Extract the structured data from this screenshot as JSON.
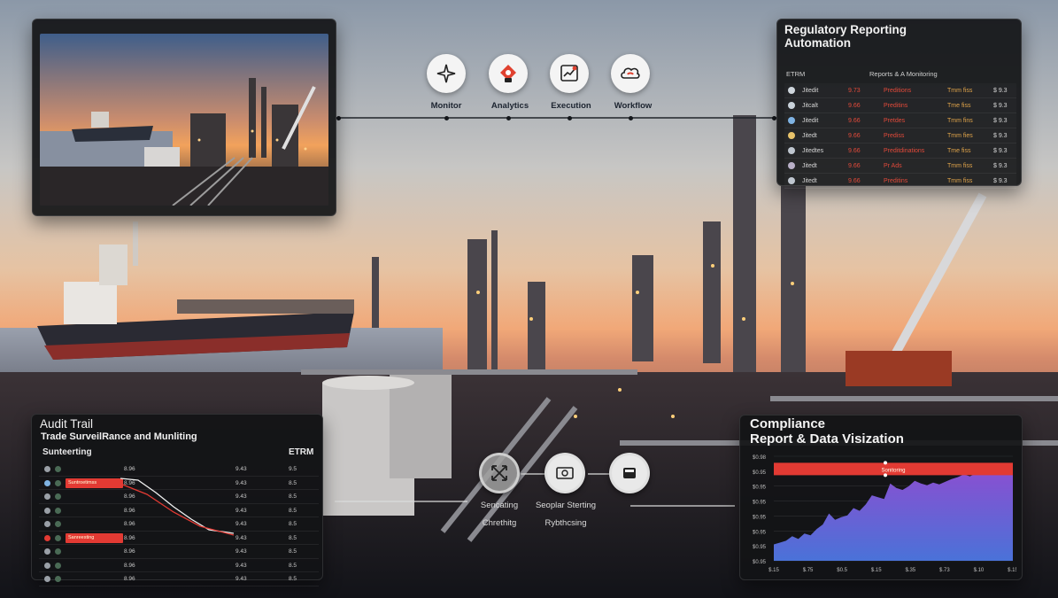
{
  "icon_bar": {
    "items": [
      {
        "label": "Monitor",
        "icon": "crosshair-icon"
      },
      {
        "label": "Analytics",
        "icon": "analytics-badge-icon"
      },
      {
        "label": "Execution",
        "icon": "execution-chart-icon"
      },
      {
        "label": "Workflow",
        "icon": "workflow-cloud-icon"
      }
    ]
  },
  "regulatory_panel": {
    "title_line1": "Regulatory Reporting",
    "title_line2": "Automation",
    "header": {
      "col1": "ETRM",
      "col2": "Reports & A Monitoring"
    },
    "rows": [
      {
        "name": "Jitedit",
        "v1": "9.73",
        "v2": "Preditions",
        "v3": "Tmm fiss",
        "v4": "$ 9.3"
      },
      {
        "name": "Jitcalt",
        "v1": "9.66",
        "v2": "Preditins",
        "v3": "Tme fiss",
        "v4": "$ 9.3"
      },
      {
        "name": "Jitedit",
        "v1": "9.66",
        "v2": "Pretdes",
        "v3": "Tmm fins",
        "v4": "$ 9.3"
      },
      {
        "name": "Jitedt",
        "v1": "9.66",
        "v2": "Prediss",
        "v3": "Tmm fies",
        "v4": "$ 9.3"
      },
      {
        "name": "Jitedtes",
        "v1": "9.66",
        "v2": "Preditdinations",
        "v3": "Tme fiss",
        "v4": "$ 9.3"
      },
      {
        "name": "Jitedt",
        "v1": "9.66",
        "v2": "Pr Ads",
        "v3": "Tmm fiss",
        "v4": "$ 9.3"
      },
      {
        "name": "Jitedt",
        "v1": "9.66",
        "v2": "Preditins",
        "v3": "Tmm fiss",
        "v4": "$ 9.3"
      }
    ]
  },
  "audit_panel": {
    "title": "Audit Trail",
    "subtitle": "Trade SurveilRance and Munliting",
    "header": {
      "col1": "Sunteerting",
      "col2": "ETRM"
    },
    "rows": [
      {
        "flag": "",
        "v1": "8.96",
        "v2": "9.43",
        "v3": "9.5"
      },
      {
        "flag": "Suntroetimss",
        "v1": "8.96",
        "v2": "9.43",
        "v3": "8.5"
      },
      {
        "flag": "",
        "v1": "8.96",
        "v2": "9.43",
        "v3": "8.5"
      },
      {
        "flag": "",
        "v1": "8.96",
        "v2": "9.43",
        "v3": "8.5"
      },
      {
        "flag": "",
        "v1": "8.96",
        "v2": "9.43",
        "v3": "8.5"
      },
      {
        "flag": "Sanreesting",
        "v1": "8.96",
        "v2": "9.43",
        "v3": "8.5"
      },
      {
        "flag": "",
        "v1": "8.96",
        "v2": "9.43",
        "v3": "8.5"
      },
      {
        "flag": "",
        "v1": "8.96",
        "v2": "9.43",
        "v3": "8.5"
      },
      {
        "flag": "",
        "v1": "8.96",
        "v2": "9.43",
        "v3": "8.5"
      }
    ]
  },
  "bottom_hubs": {
    "items": [
      {
        "label": "Sencating",
        "icon": "shuffle-icon"
      },
      {
        "label": "Seoplar Sterting",
        "icon": "money-card-icon"
      },
      {
        "label": "",
        "icon": "storage-box-icon"
      }
    ],
    "sublabels": [
      "Chrethitg",
      "Rybthcsing"
    ]
  },
  "compliance_panel": {
    "title_line1": "Compliance",
    "title_line2": "Report & Data Visization",
    "threshold_label": "Sonitoring",
    "colors": {
      "threshold": "#e23a33",
      "area_top": "#8a4fd1",
      "area_bottom": "#4a72d8"
    }
  },
  "chart_data": {
    "type": "area",
    "title": "Report & Data Visization",
    "ytick_labels": [
      "$0.98",
      "$0.95",
      "$0.95",
      "$0.95",
      "$0.95",
      "$0.95",
      "$0.95",
      "$0.95"
    ],
    "xtick_labels": [
      "$.15",
      "$.75",
      "$0.5",
      "$.15",
      "$.35",
      "$.73",
      "$.10",
      "$.15"
    ],
    "x": [
      0,
      1,
      2,
      3,
      4,
      5,
      6,
      7,
      8,
      9,
      10,
      11,
      12,
      13,
      14,
      15,
      16,
      17,
      18,
      19,
      20,
      21,
      22,
      23,
      24,
      25,
      26,
      27,
      28,
      29,
      30,
      31,
      32,
      33,
      34,
      35,
      36,
      37,
      38,
      39
    ],
    "values": [
      18,
      20,
      22,
      27,
      24,
      30,
      28,
      35,
      40,
      52,
      45,
      48,
      50,
      58,
      55,
      62,
      72,
      70,
      68,
      85,
      80,
      78,
      82,
      88,
      85,
      83,
      86,
      84,
      87,
      90,
      92,
      95,
      93,
      96,
      98,
      95,
      100,
      97,
      99,
      101
    ],
    "threshold": 100,
    "ylim": [
      0,
      115
    ],
    "grid": true
  }
}
